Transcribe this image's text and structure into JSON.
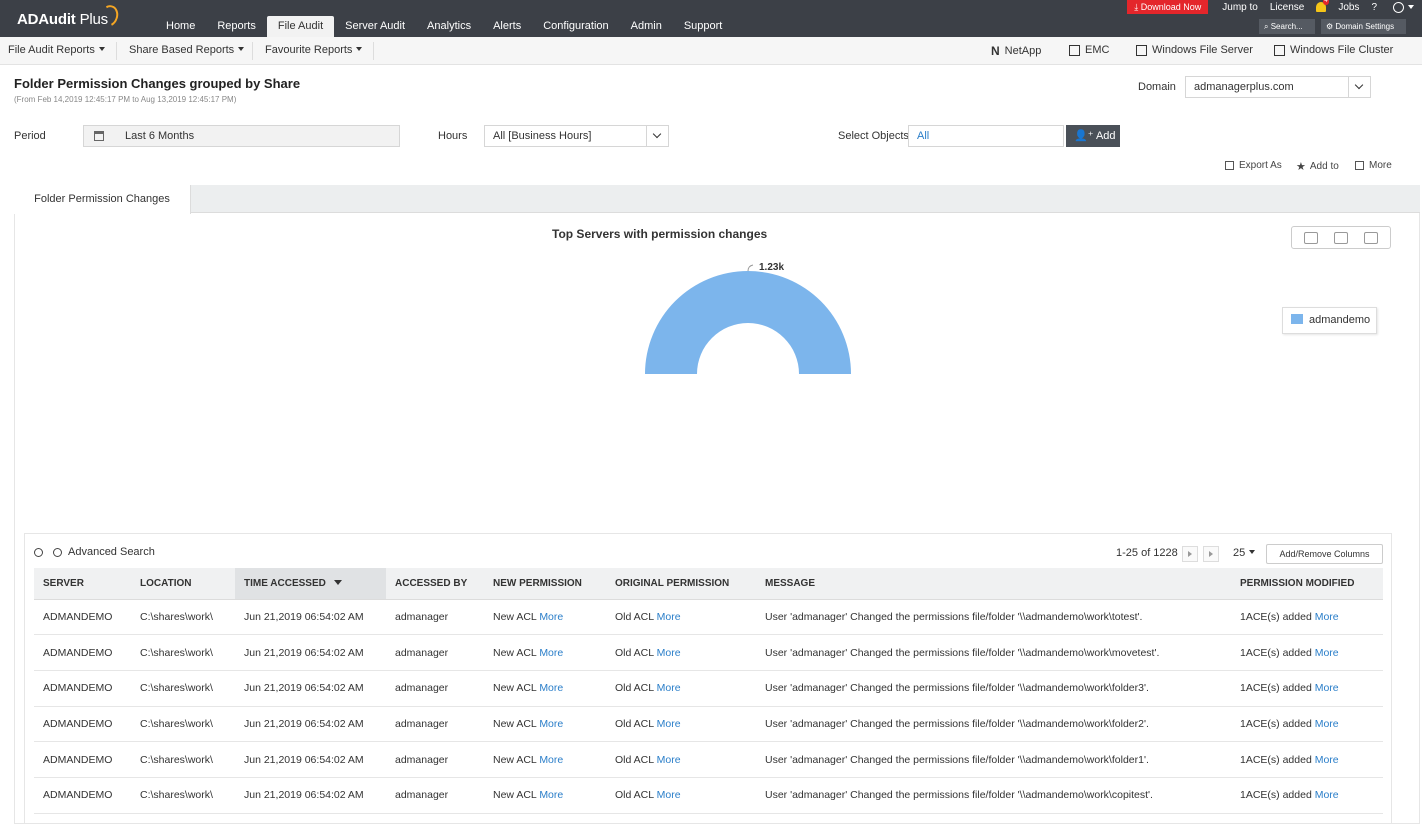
{
  "app": {
    "logo_main": "ADAudit",
    "logo_plus": "Plus"
  },
  "top_right": {
    "download": "Download Now",
    "jump_to": "Jump to",
    "license": "License",
    "notifications": "4",
    "jobs": "Jobs",
    "help": "?",
    "search": "Search...",
    "domain_settings": "Domain Settings"
  },
  "main_nav": [
    "Home",
    "Reports",
    "File Audit",
    "Server Audit",
    "Analytics",
    "Alerts",
    "Configuration",
    "Admin",
    "Support"
  ],
  "main_nav_active": "File Audit",
  "sub_nav": {
    "file_audit_reports": "File Audit Reports",
    "share_based_reports": "Share Based Reports",
    "favourite_reports": "Favourite Reports",
    "netapp_letter": "N",
    "netapp": "NetApp",
    "emc": "EMC",
    "windows_file_server": "Windows File Server",
    "windows_file_cluster": "Windows File Cluster"
  },
  "header": {
    "title": "Folder Permission Changes grouped by Share",
    "subtitle": "(From Feb 14,2019 12:45:17 PM to Aug 13,2019 12:45:17 PM)",
    "domain_label": "Domain",
    "domain_value": "admanagerplus.com"
  },
  "filters": {
    "period_label": "Period",
    "period_value": "Last 6 Months",
    "hours_label": "Hours",
    "hours_value": "All [Business Hours]",
    "objects_label": "Select Objects",
    "objects_value": "All",
    "add_label": "Add"
  },
  "actions": {
    "export": "Export As",
    "add_to": "Add to",
    "more": "More"
  },
  "tab": {
    "label": "Folder Permission Changes"
  },
  "chart_data": {
    "type": "pie",
    "title": "Top Servers with permission changes",
    "categories": [
      "admandemo"
    ],
    "values": [
      1228
    ],
    "data_labels": [
      "1.23k"
    ],
    "legend": [
      "admandemo"
    ],
    "legend_placement": "right",
    "colors": [
      "#7cb5ec"
    ]
  },
  "grid": {
    "advanced_search": "Advanced Search",
    "pager_text": "1-25 of 1228",
    "page_size": "25",
    "add_remove_columns": "Add/Remove Columns",
    "columns": [
      "SERVER",
      "LOCATION",
      "TIME ACCESSED",
      "ACCESSED BY",
      "NEW PERMISSION",
      "ORIGINAL PERMISSION",
      "MESSAGE",
      "PERMISSION MODIFIED"
    ],
    "more_link": "More",
    "rows": [
      {
        "server": "ADMANDEMO",
        "location": "C:\\shares\\work\\",
        "time": "Jun 21,2019 06:54:02 AM",
        "by": "admanager",
        "new": "New ACL",
        "orig": "Old ACL",
        "message": "User 'admanager' Changed the permissions file/folder '\\\\admandemo\\work\\totest'.",
        "modified": "1ACE(s) added"
      },
      {
        "server": "ADMANDEMO",
        "location": "C:\\shares\\work\\",
        "time": "Jun 21,2019 06:54:02 AM",
        "by": "admanager",
        "new": "New ACL",
        "orig": "Old ACL",
        "message": "User 'admanager' Changed the permissions file/folder '\\\\admandemo\\work\\movetest'.",
        "modified": "1ACE(s) added"
      },
      {
        "server": "ADMANDEMO",
        "location": "C:\\shares\\work\\",
        "time": "Jun 21,2019 06:54:02 AM",
        "by": "admanager",
        "new": "New ACL",
        "orig": "Old ACL",
        "message": "User 'admanager' Changed the permissions file/folder '\\\\admandemo\\work\\folder3'.",
        "modified": "1ACE(s) added"
      },
      {
        "server": "ADMANDEMO",
        "location": "C:\\shares\\work\\",
        "time": "Jun 21,2019 06:54:02 AM",
        "by": "admanager",
        "new": "New ACL",
        "orig": "Old ACL",
        "message": "User 'admanager' Changed the permissions file/folder '\\\\admandemo\\work\\folder2'.",
        "modified": "1ACE(s) added"
      },
      {
        "server": "ADMANDEMO",
        "location": "C:\\shares\\work\\",
        "time": "Jun 21,2019 06:54:02 AM",
        "by": "admanager",
        "new": "New ACL",
        "orig": "Old ACL",
        "message": "User 'admanager' Changed the permissions file/folder '\\\\admandemo\\work\\folder1'.",
        "modified": "1ACE(s) added"
      },
      {
        "server": "ADMANDEMO",
        "location": "C:\\shares\\work\\",
        "time": "Jun 21,2019 06:54:02 AM",
        "by": "admanager",
        "new": "New ACL",
        "orig": "Old ACL",
        "message": "User 'admanager' Changed the permissions file/folder '\\\\admandemo\\work\\copitest'.",
        "modified": "1ACE(s) added"
      }
    ]
  }
}
